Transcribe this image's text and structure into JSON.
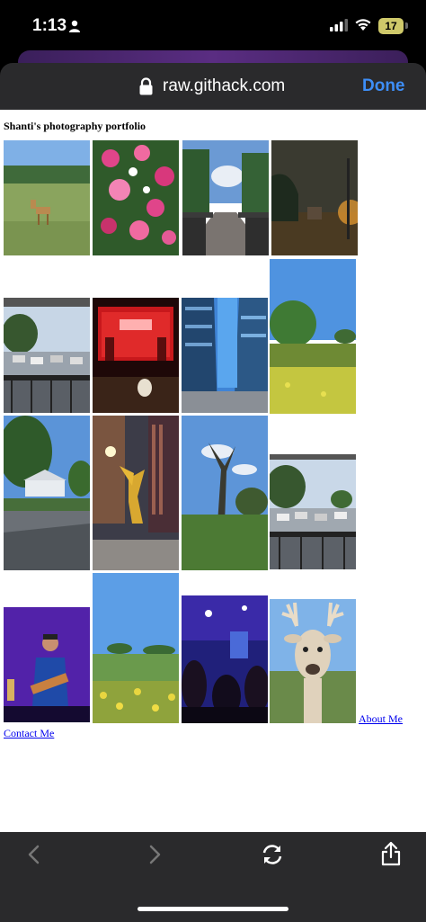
{
  "status_bar": {
    "time": "1:13",
    "battery": "17",
    "icons": [
      "person-icon",
      "signal-icon",
      "wifi-icon",
      "battery-icon"
    ]
  },
  "browser": {
    "url": "raw.githack.com",
    "done_label": "Done",
    "toolbar_icons": [
      "back-icon",
      "forward-icon",
      "reload-icon",
      "share-icon"
    ]
  },
  "page": {
    "title": "Shanti's photography portfolio",
    "photos": [
      "deer-in-field-photo",
      "pink-flowers-photo",
      "wooden-boardwalk-photo",
      "night-street-photo",
      "blue-sky-meadow-photo",
      "balcony-cars-photo",
      "red-neon-bar-photo",
      "glass-skyscrapers-photo",
      "tree-plaza-photo",
      "golden-statue-photo",
      "park-trees-photo",
      "parking-lot-photo",
      "concert-singer-photo",
      "yellow-wildflowers-photo",
      "crowd-blue-lights-photo",
      "deer-statue-photo"
    ],
    "about_link": "About Me",
    "contact_link": "Contact Me"
  }
}
